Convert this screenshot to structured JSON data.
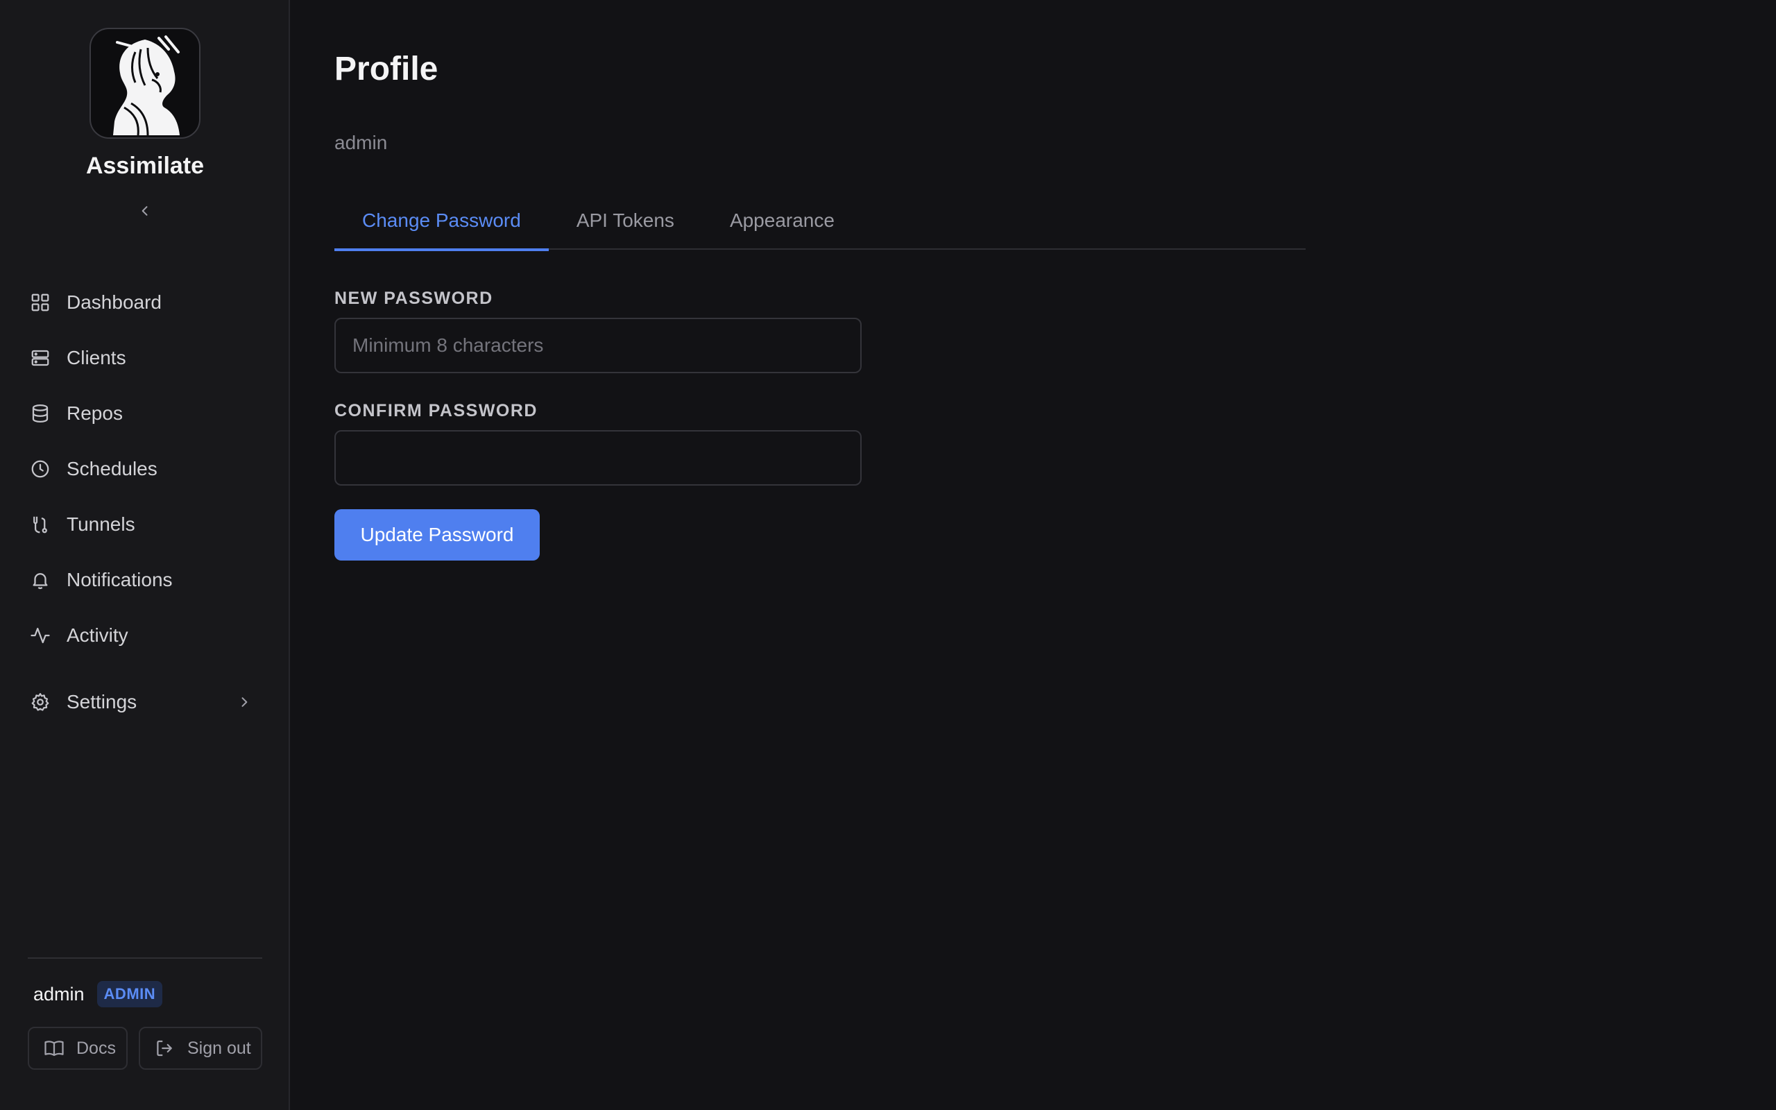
{
  "sidebar": {
    "brand": "Assimilate",
    "logo_icon": "alien-portrait-logo",
    "collapse_icon": "chevron-left-icon",
    "items": [
      {
        "label": "Dashboard",
        "icon": "grid-icon"
      },
      {
        "label": "Clients",
        "icon": "server-icon"
      },
      {
        "label": "Repos",
        "icon": "database-icon"
      },
      {
        "label": "Schedules",
        "icon": "clock-icon"
      },
      {
        "label": "Tunnels",
        "icon": "route-icon"
      },
      {
        "label": "Notifications",
        "icon": "bell-icon"
      },
      {
        "label": "Activity",
        "icon": "activity-icon"
      }
    ],
    "settings": {
      "label": "Settings",
      "icon": "gear-icon",
      "chevron": "chevron-right-icon"
    },
    "user": {
      "name": "admin",
      "role": "ADMIN"
    },
    "docs_label": "Docs",
    "signout_label": "Sign out"
  },
  "main": {
    "title": "Profile",
    "subtitle": "admin",
    "tabs": [
      {
        "label": "Change Password",
        "active": true
      },
      {
        "label": "API Tokens",
        "active": false
      },
      {
        "label": "Appearance",
        "active": false
      }
    ],
    "form": {
      "new_password_label": "NEW PASSWORD",
      "new_password_placeholder": "Minimum 8 characters",
      "new_password_value": "",
      "confirm_password_label": "CONFIRM PASSWORD",
      "confirm_password_value": "",
      "submit_label": "Update Password"
    }
  },
  "colors": {
    "background": "#121215",
    "sidebar": "#18181b",
    "accent": "#4f7fef",
    "badge_bg": "#1e2a47"
  }
}
